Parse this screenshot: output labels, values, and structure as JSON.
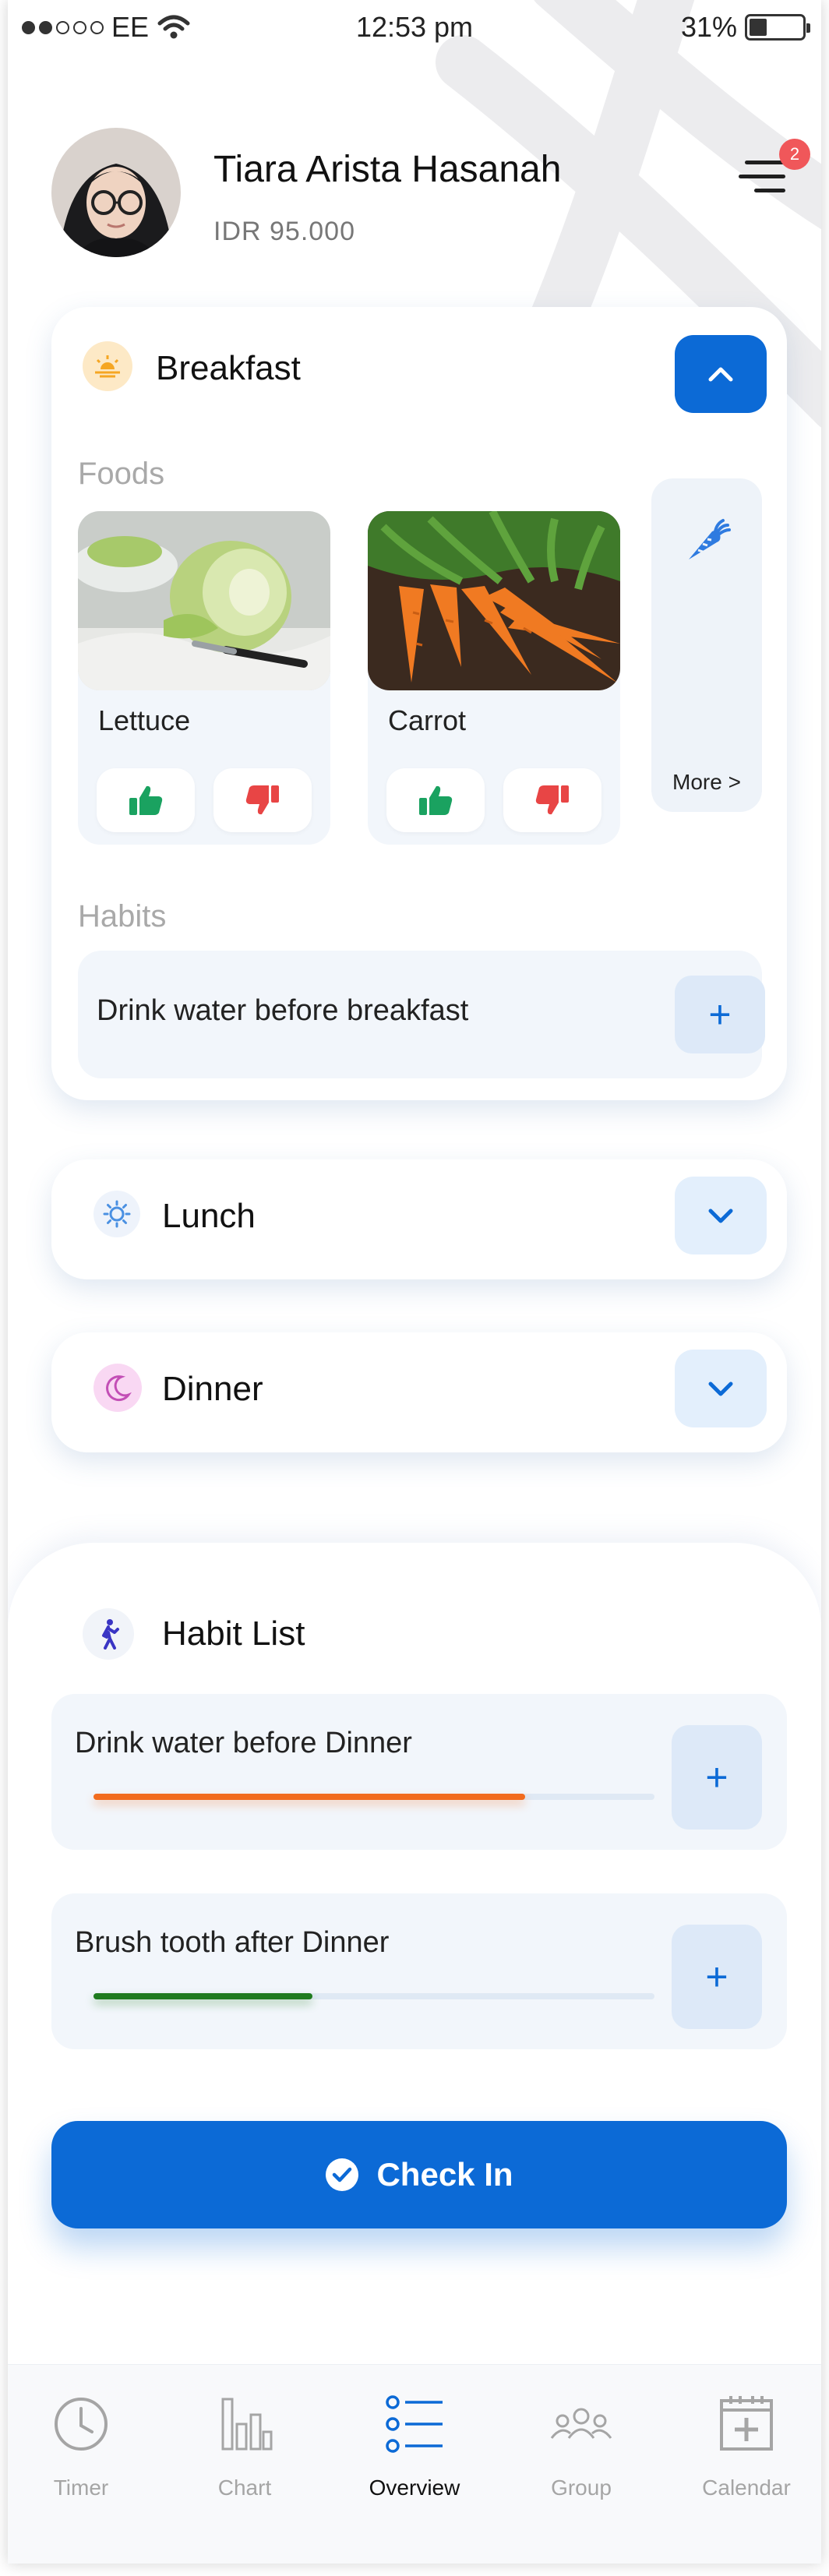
{
  "status_bar": {
    "carrier": "EE",
    "time": "12:53 pm",
    "battery": "31%"
  },
  "profile": {
    "name": "Tiara Arista Hasanah",
    "balance": "IDR 95.000",
    "notification_count": "2"
  },
  "breakfast": {
    "title": "Breakfast",
    "foods_label": "Foods",
    "foods": [
      {
        "name": "Lettuce"
      },
      {
        "name": "Carrot"
      }
    ],
    "more_label": "More >",
    "habits_label": "Habits",
    "habit": "Drink water before breakfast",
    "plus": "+"
  },
  "lunch": {
    "title": "Lunch"
  },
  "dinner": {
    "title": "Dinner"
  },
  "habit_list": {
    "title": "Habit List",
    "items": [
      {
        "text": "Drink water before Dinner",
        "progress": 0.77,
        "color": "#f26b1d"
      },
      {
        "text": "Brush tooth after Dinner",
        "progress": 0.39,
        "color": "#1e7b1e"
      }
    ],
    "plus": "+"
  },
  "checkin": {
    "label": "Check In"
  },
  "nav": [
    {
      "label": "Timer",
      "icon": "clock-icon"
    },
    {
      "label": "Chart",
      "icon": "bar-chart-icon"
    },
    {
      "label": "Overview",
      "icon": "list-icon",
      "active": true
    },
    {
      "label": "Group",
      "icon": "group-icon"
    },
    {
      "label": "Calendar",
      "icon": "calendar-add-icon"
    }
  ],
  "colors": {
    "primary": "#0c6ad6",
    "light_blue": "#e3effc",
    "badge_red": "#f0575a",
    "like_green": "#1aa260",
    "dislike_red": "#e84545"
  }
}
